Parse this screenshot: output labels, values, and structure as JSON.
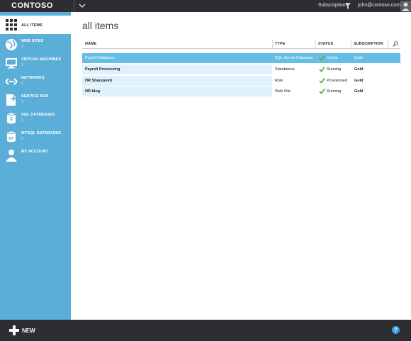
{
  "app": {
    "brand": "CONTOSO"
  },
  "header": {
    "subscriptions_label": "Subscriptions",
    "user_email": "john@contoso.com"
  },
  "sidebar": {
    "items": [
      {
        "label": "ALL ITEMS",
        "count": "",
        "icon": "grid-icon",
        "active": true
      },
      {
        "label": "WEB SITES",
        "count": "1",
        "icon": "globe-icon"
      },
      {
        "label": "VIRTUAL MACHINES",
        "count": "2",
        "icon": "monitor-icon"
      },
      {
        "label": "NETWORKS",
        "count": "0",
        "icon": "network-icon"
      },
      {
        "label": "SERVICE BUS",
        "count": "1",
        "icon": "service-bus-icon"
      },
      {
        "label": "SQL DATABASES",
        "count": "1",
        "icon": "database-icon"
      },
      {
        "label": "MYSQL DATABASES",
        "count": "0",
        "icon": "mysql-database-icon"
      },
      {
        "label": "MY ACCOUNT",
        "count": "",
        "icon": "person-icon"
      }
    ]
  },
  "main": {
    "title": "all items",
    "columns": {
      "name": "NAME",
      "type": "TYPE",
      "status": "STATUS",
      "subscription": "SUBSCRIPTION"
    },
    "rows": [
      {
        "name": "Payroll Database",
        "type": "SQL Server Database",
        "status": "Online",
        "subscription": "Gold",
        "selected": true
      },
      {
        "name": "Payroll Processing",
        "type": "Standalone",
        "status": "Running",
        "subscription": "Gold"
      },
      {
        "name": "HR Sharepoint",
        "type": "Role",
        "status": "Provisioned",
        "subscription": "Gold"
      },
      {
        "name": "HR blog",
        "type": "Web Site",
        "status": "Running",
        "subscription": "Gold"
      }
    ]
  },
  "footer": {
    "new_label": "NEW",
    "help_label": "?"
  },
  "colors": {
    "sidebar": "#5aaed8",
    "bar": "#2c2e33",
    "selected_row": "#66bde6",
    "row": "#dff2fb",
    "status_check": "#5bb033"
  }
}
